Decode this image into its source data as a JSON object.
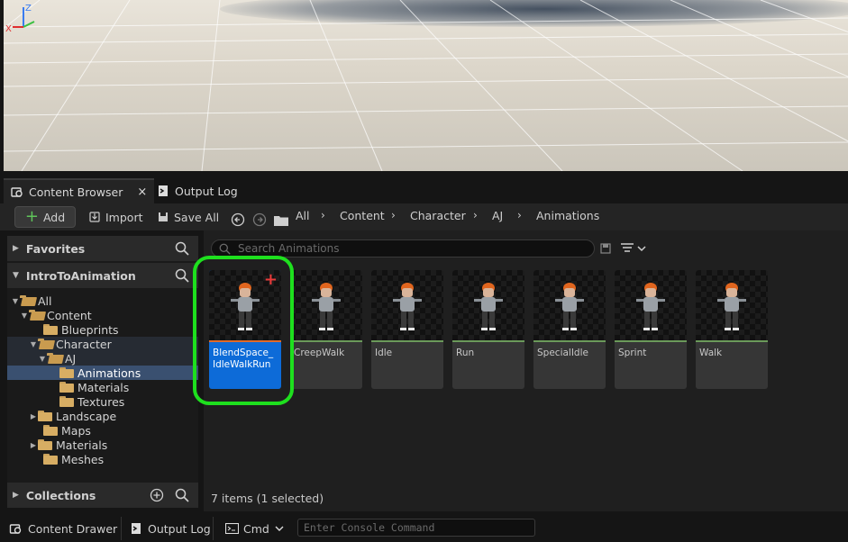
{
  "tabs": {
    "content_browser": "Content Browser",
    "close_glyph": "×",
    "output_log": "Output Log"
  },
  "toolbar": {
    "add_label": "Add",
    "import_label": "Import",
    "save_all_label": "Save All",
    "breadcrumb": [
      "All",
      "Content",
      "Character",
      "AJ",
      "Animations"
    ]
  },
  "sidebar": {
    "favorites_label": "Favorites",
    "project_label": "IntroToAnimation",
    "collections_label": "Collections",
    "tree": [
      {
        "label": "All",
        "state": "open"
      },
      {
        "label": "Content",
        "state": "open"
      },
      {
        "label": "Blueprints",
        "state": "leaf"
      },
      {
        "label": "Character",
        "state": "open"
      },
      {
        "label": "AJ",
        "state": "open"
      },
      {
        "label": "Animations",
        "state": "selected"
      },
      {
        "label": "Materials",
        "state": "leaf"
      },
      {
        "label": "Textures",
        "state": "leaf"
      },
      {
        "label": "Landscape",
        "state": "collapsed"
      },
      {
        "label": "Maps",
        "state": "leaf"
      },
      {
        "label": "Materials",
        "state": "collapsed"
      },
      {
        "label": "Meshes",
        "state": "leaf"
      }
    ]
  },
  "browser": {
    "search_placeholder": "Search Animations",
    "assets": [
      {
        "name": "BlendSpace_ IdleWalkRun",
        "selected": true
      },
      {
        "name": "CreepWalk",
        "selected": false
      },
      {
        "name": "Idle",
        "selected": false
      },
      {
        "name": "Run",
        "selected": false
      },
      {
        "name": "SpecialIdle",
        "selected": false
      },
      {
        "name": "Sprint",
        "selected": false
      },
      {
        "name": "Walk",
        "selected": false
      }
    ],
    "status": "7 items (1 selected)"
  },
  "bottombar": {
    "content_drawer": "Content Drawer",
    "output_log": "Output Log",
    "cmd_label": "Cmd",
    "console_placeholder": "Enter Console Command"
  },
  "colors": {
    "selection_blue": "#0d6bd8",
    "highlight_green": "#1ee01e",
    "add_green": "#5fc45a",
    "folder_tan": "#d7ad63"
  }
}
